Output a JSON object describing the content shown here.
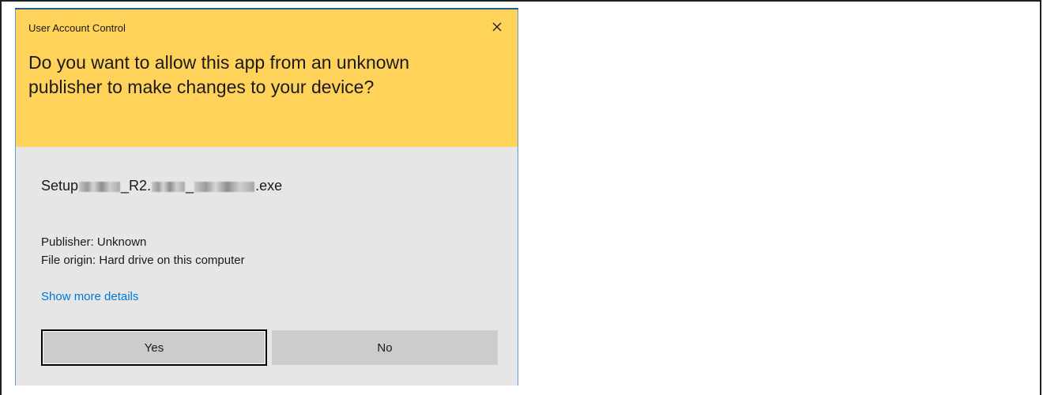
{
  "dialog": {
    "window_title": "User Account Control",
    "question": "Do you want to allow this app from an unknown publisher to make changes to your device?",
    "file": {
      "prefix": "Setup",
      "part1": "_R2.",
      "part2": "_",
      "suffix": ".exe"
    },
    "publisher": "Publisher: Unknown",
    "file_origin": "File origin: Hard drive on this computer",
    "details_link": "Show more details",
    "yes_label": "Yes",
    "no_label": "No",
    "close_icon": "close-icon"
  },
  "colors": {
    "header": "#ffd25a",
    "body": "#e6e6e6",
    "link": "#0078d7",
    "button": "#cccccc"
  }
}
